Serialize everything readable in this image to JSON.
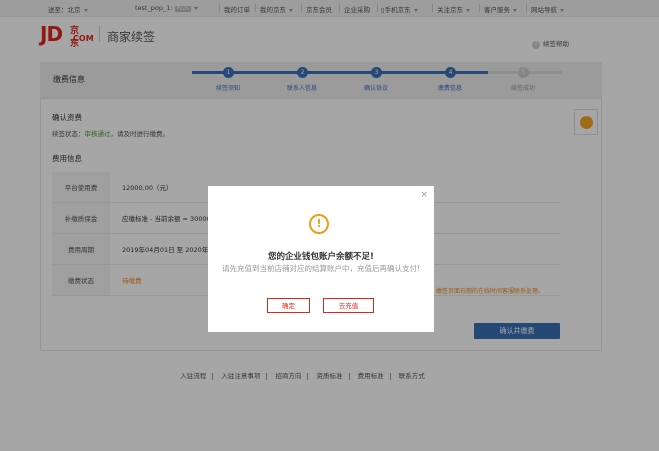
{
  "topbar": {
    "location": "送至：北京",
    "user": "test_pop_1:",
    "plus": "PLUS",
    "links": [
      "我的订单",
      "我的京东",
      "京东会员",
      "企业采购",
      "手机京东",
      "关注京东",
      "客户服务",
      "网站导航"
    ]
  },
  "header": {
    "logo_jd": "JD",
    "logo_cn": "京东",
    "logo_com": ".COM",
    "title": "商家续签",
    "help": "续签帮助",
    "help_icon": "question-circle-icon"
  },
  "panel": {
    "title": "缴费信息",
    "steps": [
      {
        "num": "1",
        "label": "续签须知",
        "done": true
      },
      {
        "num": "2",
        "label": "联系人信息",
        "done": true
      },
      {
        "num": "3",
        "label": "确认协议",
        "done": true
      },
      {
        "num": "4",
        "label": "缴费信息",
        "done": true
      },
      {
        "num": "5",
        "label": "续签成功",
        "done": false
      }
    ],
    "progress_fraction": 0.8
  },
  "confirm_section": {
    "title": "确认资费",
    "status_prefix": "续签状态：",
    "status_value": "审核通过",
    "status_suffix": "，请及时进行缴费。"
  },
  "fee_section": {
    "title": "费用信息",
    "rows": [
      {
        "label": "平台使用费",
        "value": "12000.00（元）"
      },
      {
        "label": "补缴质保金",
        "value": "应缴标准 - 当前余额 = 30000"
      },
      {
        "label": "费用周期",
        "value": "2019年04月01日 至 2020年03月"
      },
      {
        "label": "缴费状态",
        "value": "待缴费"
      }
    ],
    "warning": "缴签页面右侧的在线时间客服联系处理。",
    "confirm_button": "确认并缴费"
  },
  "footer": {
    "links": [
      "入驻流程",
      "入驻注意事项",
      "招商方向",
      "资质标准",
      "费用标准",
      "联系方式"
    ]
  },
  "modal": {
    "close": "×",
    "icon": "exclamation-circle-icon",
    "title": "您的企业钱包账户余额不足!",
    "body": "请先充值到当前店铺对应的结算账户中，充值后再确认支付!",
    "ok_button": "确定",
    "recharge_button": "去充值"
  },
  "colors": {
    "brand_red": "#e1251b",
    "step_blue": "#3a6fb6",
    "warning_orange": "#f08a1c",
    "success_green": "#52a335"
  }
}
